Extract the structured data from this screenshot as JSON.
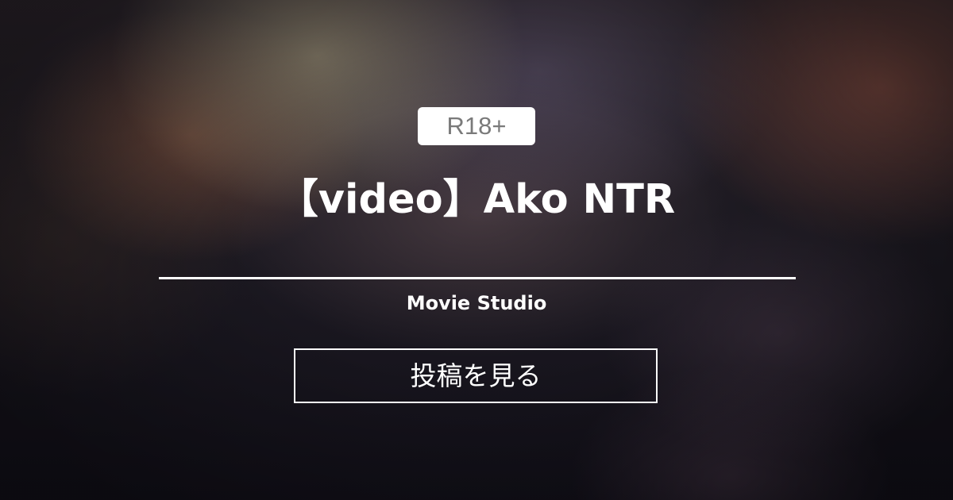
{
  "badge": {
    "label": "R18+"
  },
  "post": {
    "title": "【video】Ako NTR",
    "author": "Movie Studio"
  },
  "cta": {
    "label": "投稿を見る"
  },
  "colors": {
    "text": "#ffffff",
    "badge_bg": "#ffffff",
    "badge_text": "#7a7a7a",
    "background_dark": "#14121a"
  }
}
